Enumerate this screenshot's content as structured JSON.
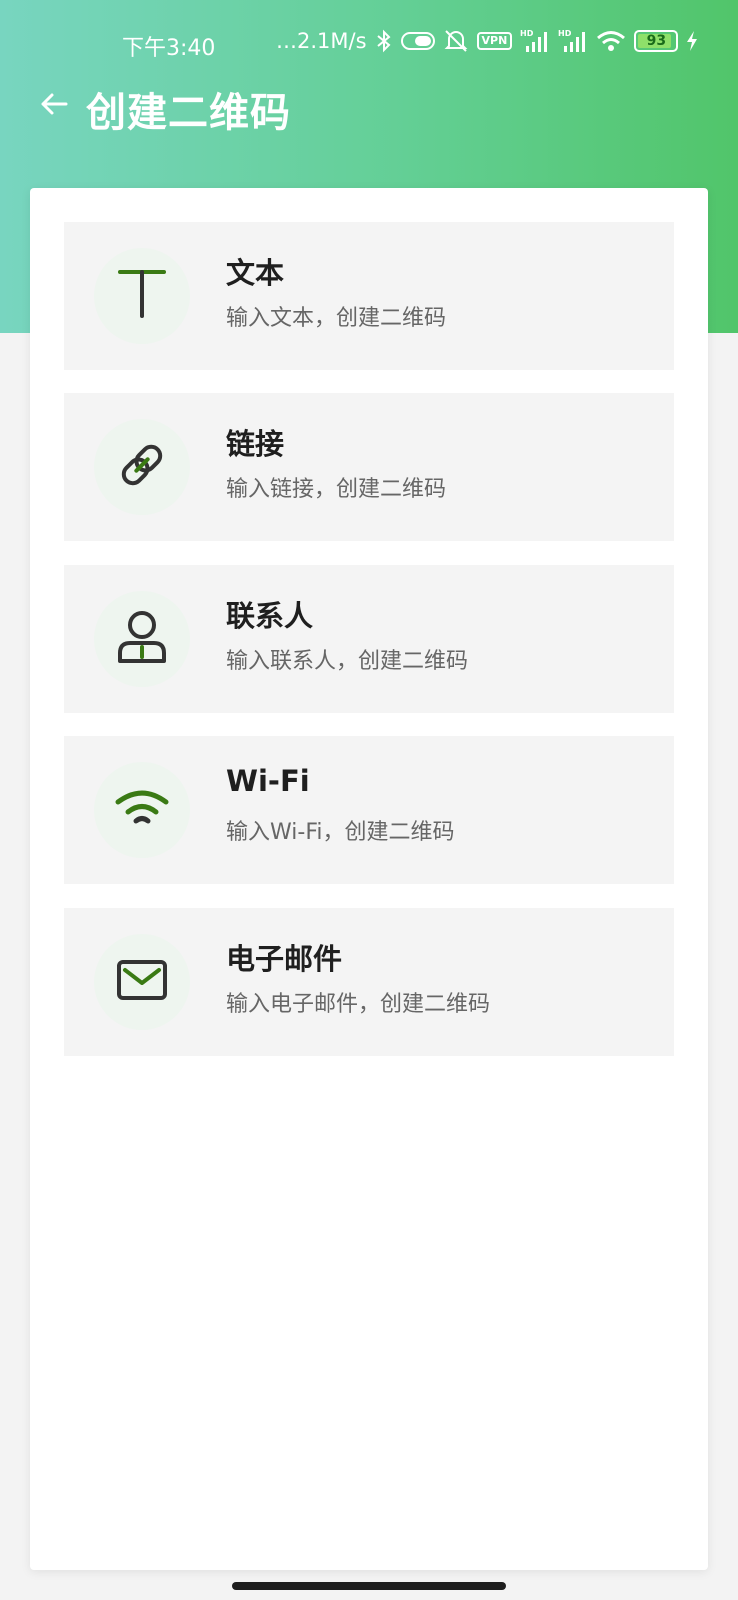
{
  "status_bar": {
    "time": "下午3:40",
    "network_speed": "…2.1M/s",
    "vpn": "VPN",
    "battery_level": "93",
    "battery_fraction": 0.93,
    "icons": [
      "bluetooth-icon",
      "toggle-icon",
      "mute-bell-icon",
      "vpn-icon",
      "hd-signal-icon",
      "hd-signal-icon",
      "wifi-icon",
      "battery-icon",
      "charging-icon"
    ]
  },
  "app_bar": {
    "title": "创建二维码",
    "back_icon": "arrow-left-icon"
  },
  "items": [
    {
      "title": "文本",
      "subtitle": "输入文本，创建二维码",
      "icon": "text-icon"
    },
    {
      "title": "链接",
      "subtitle": "输入链接，创建二维码",
      "icon": "link-icon"
    },
    {
      "title": "联系人",
      "subtitle": "输入联系人，创建二维码",
      "icon": "contact-icon"
    },
    {
      "title": "Wi-Fi",
      "subtitle": "输入Wi-Fi，创建二维码",
      "icon": "wifi-icon"
    },
    {
      "title": "电子邮件",
      "subtitle": "输入电子邮件，创建二维码",
      "icon": "email-icon"
    }
  ],
  "colors": {
    "header_start": "#78d5c0",
    "header_end": "#51c56a",
    "icon_accent": "#3a7a14",
    "icon_dark": "#333333"
  }
}
